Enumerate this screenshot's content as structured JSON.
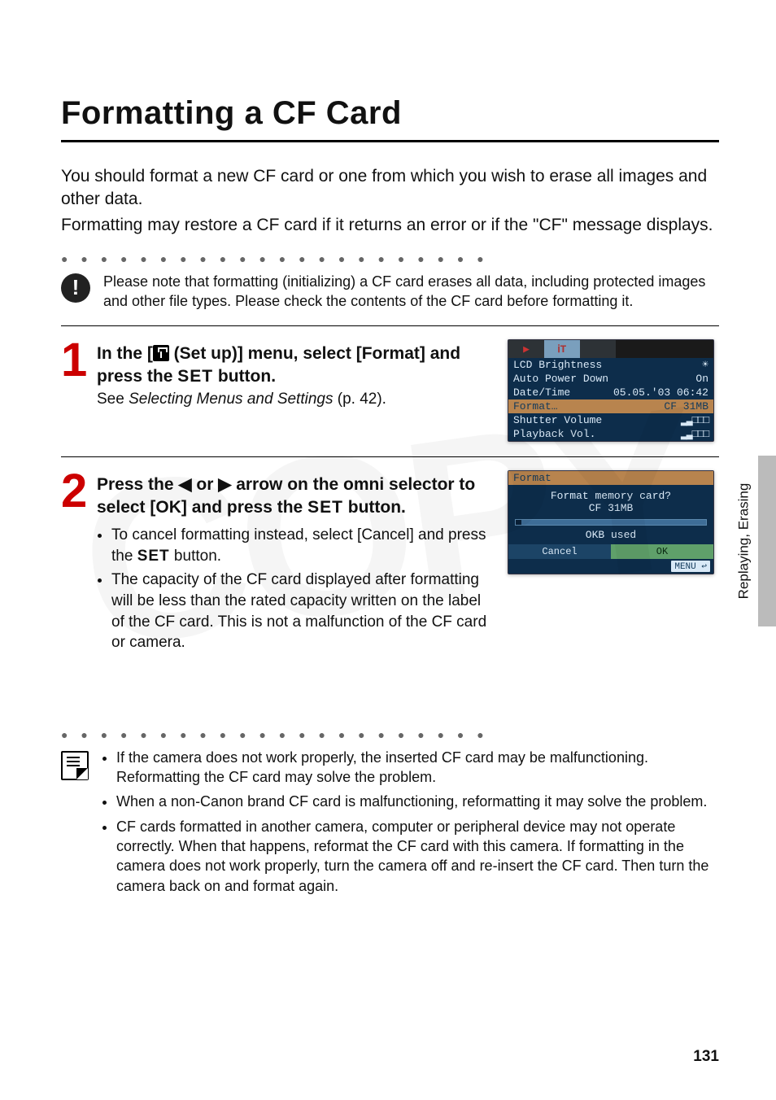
{
  "page": {
    "title": "Formatting a CF Card",
    "intro1": "You should format a new CF card or one from which you wish to erase all images and other data.",
    "intro2": "Formatting may restore a CF card if it returns an error or if the \"CF\" message displays.",
    "warning": "Please note that formatting (initializing) a CF card erases all data, including protected images and other file types. Please check the contents of the CF card before formatting it.",
    "side_label": "Replaying, Erasing",
    "page_number": "131",
    "watermark": "COPY"
  },
  "step1": {
    "num": "1",
    "heading_pre": "In the [",
    "heading_mid": " (Set up)] menu, select [Format] and press the ",
    "set_label": "SET",
    "heading_post": " button.",
    "sub_pre": "See ",
    "sub_italic": "Selecting Menus and Settings",
    "sub_post": " (p. 42)."
  },
  "lcd1": {
    "tab1": "▶",
    "tab2": "ᎥT",
    "tab3": "",
    "line1_l": "LCD Brightness",
    "line1_r": "☀",
    "line2_l": "Auto Power Down",
    "line2_r": "On",
    "line3_l": "Date/Time",
    "line3_r": "05.05.'03 06:42",
    "line4_l": "Format…",
    "line4_r": "CF 31MB",
    "line5_l": "Shutter Volume",
    "line5_r": "▂▃□□□",
    "line6_l": "Playback Vol.",
    "line6_r": "▂▃□□□"
  },
  "step2": {
    "num": "2",
    "heading_pre": "Press the ",
    "arrow_l": "◀",
    "heading_mid1": " or ",
    "arrow_r": "▶",
    "heading_mid2": " arrow on the omni selector to select [OK] and press the ",
    "set_label": "SET",
    "heading_post": " button.",
    "bullet1_pre": "To cancel formatting instead, select [Cancel] and press the ",
    "bullet1_set": "SET",
    "bullet1_post": " button.",
    "bullet2": "The capacity of the CF card displayed after formatting will be less than the rated capacity written on the label of the CF card. This is not a malfunction of the CF card or camera."
  },
  "lcd2": {
    "title": "Format",
    "line1": "Format memory card?",
    "line2": "CF 31MB",
    "line3": "OKB used",
    "btn_cancel": "Cancel",
    "btn_ok": "OK",
    "menu": "MENU ↩"
  },
  "notes": {
    "n1": "If the camera does not work properly, the inserted CF card may be malfunctioning. Reformatting the CF card may solve the problem.",
    "n2": "When a non-Canon brand CF card is malfunctioning, reformatting it may solve the problem.",
    "n3": "CF cards formatted in another camera, computer or peripheral device may not operate correctly. When that happens, reformat the CF card with this camera. If formatting in the camera does not work properly, turn the camera off and re-insert the CF card. Then turn the camera back on and format again."
  }
}
